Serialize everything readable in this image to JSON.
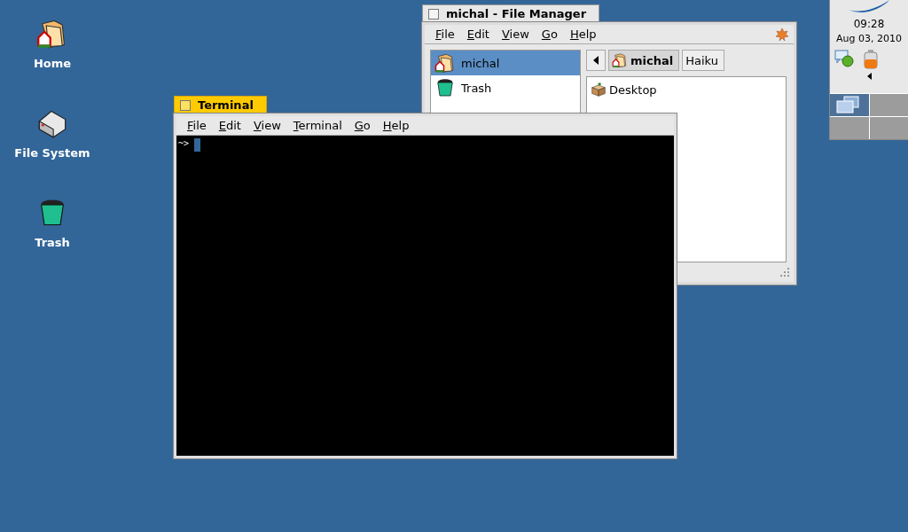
{
  "desktop": {
    "icons": [
      {
        "label": "Home",
        "kind": "home"
      },
      {
        "label": "File System",
        "kind": "disk"
      },
      {
        "label": "Trash",
        "kind": "trash"
      }
    ]
  },
  "file_manager": {
    "title": "michal - File Manager",
    "active": false,
    "menu": [
      "File",
      "Edit",
      "View",
      "Go",
      "Help"
    ],
    "sidebar": [
      {
        "label": "michal",
        "kind": "home",
        "selected": true
      },
      {
        "label": "Trash",
        "kind": "trash",
        "selected": false
      }
    ],
    "path": [
      {
        "label": "michal",
        "kind": "home",
        "selected": true
      },
      {
        "label": "Haiku",
        "selected": false
      }
    ],
    "files": [
      {
        "label": "Desktop",
        "kind": "desk"
      }
    ]
  },
  "terminal": {
    "title": "Terminal",
    "active": true,
    "menu": [
      "File",
      "Edit",
      "View",
      "Terminal",
      "Go",
      "Help"
    ],
    "prompt": "~>"
  },
  "deskbar": {
    "time": "09:28",
    "date": "Aug 03, 2010",
    "workspaces": [
      {
        "selected": true
      },
      {
        "selected": false
      },
      {
        "selected": false
      },
      {
        "selected": false
      }
    ]
  }
}
